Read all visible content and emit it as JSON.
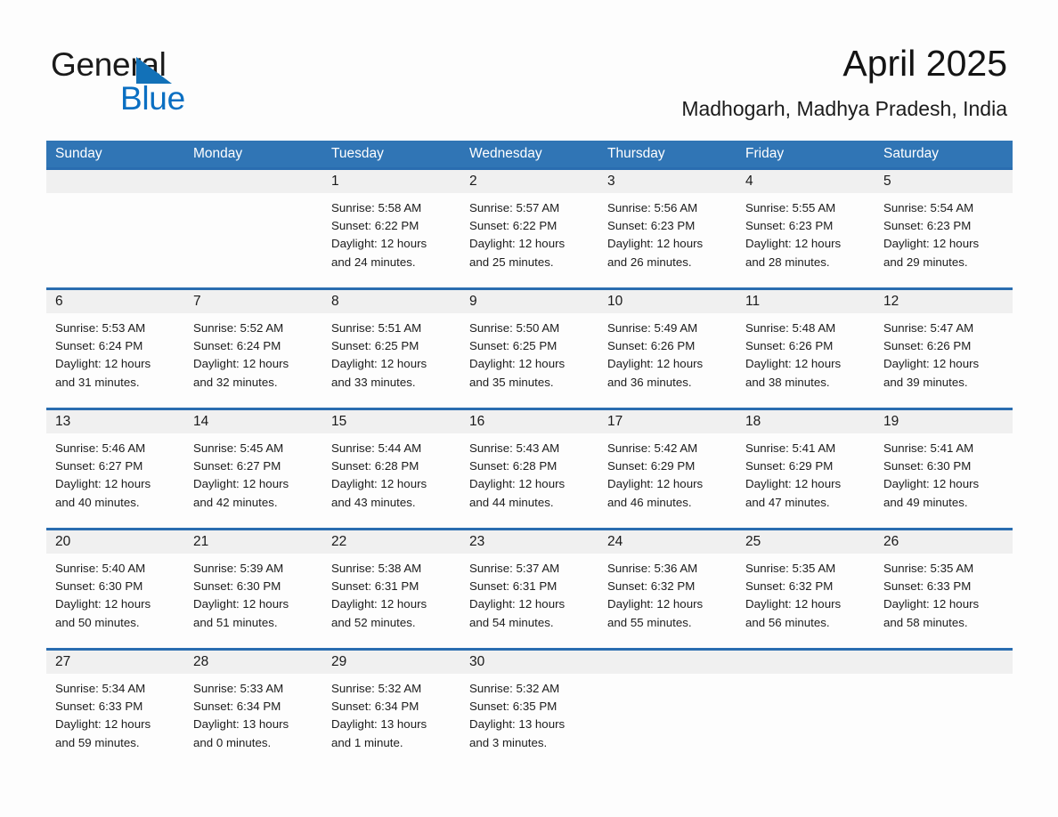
{
  "brand": {
    "name_part1": "General",
    "name_part2": "Blue",
    "triangle_icon": "brand-triangle-icon",
    "accent_color": "#0a6fc2"
  },
  "header": {
    "title": "April 2025",
    "location": "Madhogarh, Madhya Pradesh, India"
  },
  "calendar": {
    "header_bg": "#3075b5",
    "rule_color": "#2a6db0",
    "day_band_bg": "#f0f0f0",
    "weekdays": [
      "Sunday",
      "Monday",
      "Tuesday",
      "Wednesday",
      "Thursday",
      "Friday",
      "Saturday"
    ],
    "weeks": [
      [
        {
          "day": "",
          "info": ""
        },
        {
          "day": "",
          "info": ""
        },
        {
          "day": "1",
          "info": "Sunrise: 5:58 AM\nSunset: 6:22 PM\nDaylight: 12 hours\nand 24 minutes."
        },
        {
          "day": "2",
          "info": "Sunrise: 5:57 AM\nSunset: 6:22 PM\nDaylight: 12 hours\nand 25 minutes."
        },
        {
          "day": "3",
          "info": "Sunrise: 5:56 AM\nSunset: 6:23 PM\nDaylight: 12 hours\nand 26 minutes."
        },
        {
          "day": "4",
          "info": "Sunrise: 5:55 AM\nSunset: 6:23 PM\nDaylight: 12 hours\nand 28 minutes."
        },
        {
          "day": "5",
          "info": "Sunrise: 5:54 AM\nSunset: 6:23 PM\nDaylight: 12 hours\nand 29 minutes."
        }
      ],
      [
        {
          "day": "6",
          "info": "Sunrise: 5:53 AM\nSunset: 6:24 PM\nDaylight: 12 hours\nand 31 minutes."
        },
        {
          "day": "7",
          "info": "Sunrise: 5:52 AM\nSunset: 6:24 PM\nDaylight: 12 hours\nand 32 minutes."
        },
        {
          "day": "8",
          "info": "Sunrise: 5:51 AM\nSunset: 6:25 PM\nDaylight: 12 hours\nand 33 minutes."
        },
        {
          "day": "9",
          "info": "Sunrise: 5:50 AM\nSunset: 6:25 PM\nDaylight: 12 hours\nand 35 minutes."
        },
        {
          "day": "10",
          "info": "Sunrise: 5:49 AM\nSunset: 6:26 PM\nDaylight: 12 hours\nand 36 minutes."
        },
        {
          "day": "11",
          "info": "Sunrise: 5:48 AM\nSunset: 6:26 PM\nDaylight: 12 hours\nand 38 minutes."
        },
        {
          "day": "12",
          "info": "Sunrise: 5:47 AM\nSunset: 6:26 PM\nDaylight: 12 hours\nand 39 minutes."
        }
      ],
      [
        {
          "day": "13",
          "info": "Sunrise: 5:46 AM\nSunset: 6:27 PM\nDaylight: 12 hours\nand 40 minutes."
        },
        {
          "day": "14",
          "info": "Sunrise: 5:45 AM\nSunset: 6:27 PM\nDaylight: 12 hours\nand 42 minutes."
        },
        {
          "day": "15",
          "info": "Sunrise: 5:44 AM\nSunset: 6:28 PM\nDaylight: 12 hours\nand 43 minutes."
        },
        {
          "day": "16",
          "info": "Sunrise: 5:43 AM\nSunset: 6:28 PM\nDaylight: 12 hours\nand 44 minutes."
        },
        {
          "day": "17",
          "info": "Sunrise: 5:42 AM\nSunset: 6:29 PM\nDaylight: 12 hours\nand 46 minutes."
        },
        {
          "day": "18",
          "info": "Sunrise: 5:41 AM\nSunset: 6:29 PM\nDaylight: 12 hours\nand 47 minutes."
        },
        {
          "day": "19",
          "info": "Sunrise: 5:41 AM\nSunset: 6:30 PM\nDaylight: 12 hours\nand 49 minutes."
        }
      ],
      [
        {
          "day": "20",
          "info": "Sunrise: 5:40 AM\nSunset: 6:30 PM\nDaylight: 12 hours\nand 50 minutes."
        },
        {
          "day": "21",
          "info": "Sunrise: 5:39 AM\nSunset: 6:30 PM\nDaylight: 12 hours\nand 51 minutes."
        },
        {
          "day": "22",
          "info": "Sunrise: 5:38 AM\nSunset: 6:31 PM\nDaylight: 12 hours\nand 52 minutes."
        },
        {
          "day": "23",
          "info": "Sunrise: 5:37 AM\nSunset: 6:31 PM\nDaylight: 12 hours\nand 54 minutes."
        },
        {
          "day": "24",
          "info": "Sunrise: 5:36 AM\nSunset: 6:32 PM\nDaylight: 12 hours\nand 55 minutes."
        },
        {
          "day": "25",
          "info": "Sunrise: 5:35 AM\nSunset: 6:32 PM\nDaylight: 12 hours\nand 56 minutes."
        },
        {
          "day": "26",
          "info": "Sunrise: 5:35 AM\nSunset: 6:33 PM\nDaylight: 12 hours\nand 58 minutes."
        }
      ],
      [
        {
          "day": "27",
          "info": "Sunrise: 5:34 AM\nSunset: 6:33 PM\nDaylight: 12 hours\nand 59 minutes."
        },
        {
          "day": "28",
          "info": "Sunrise: 5:33 AM\nSunset: 6:34 PM\nDaylight: 13 hours\nand 0 minutes."
        },
        {
          "day": "29",
          "info": "Sunrise: 5:32 AM\nSunset: 6:34 PM\nDaylight: 13 hours\nand 1 minute."
        },
        {
          "day": "30",
          "info": "Sunrise: 5:32 AM\nSunset: 6:35 PM\nDaylight: 13 hours\nand 3 minutes."
        },
        {
          "day": "",
          "info": ""
        },
        {
          "day": "",
          "info": ""
        },
        {
          "day": "",
          "info": ""
        }
      ]
    ]
  }
}
